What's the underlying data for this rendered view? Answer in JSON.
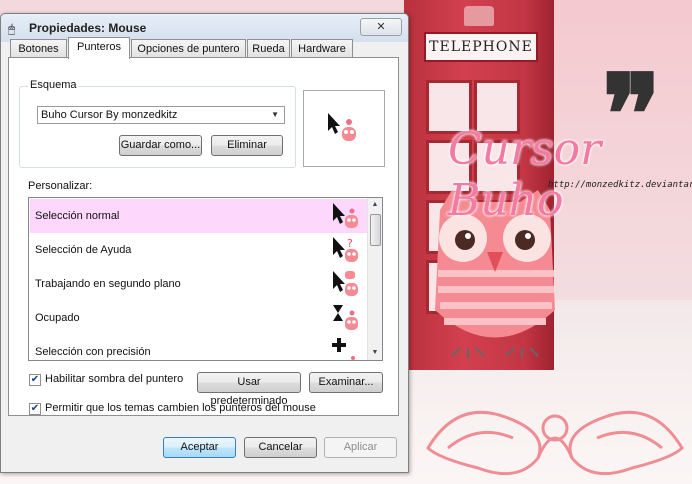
{
  "window": {
    "title": "Propiedades: Mouse",
    "close_label": "✕"
  },
  "tabs": [
    {
      "label": "Botones"
    },
    {
      "label": "Punteros"
    },
    {
      "label": "Opciones de puntero"
    },
    {
      "label": "Rueda"
    },
    {
      "label": "Hardware"
    }
  ],
  "scheme": {
    "group_label": "Esquema",
    "selected": "Buho Cursor By monzedkitz",
    "save_label": "Guardar como...",
    "delete_label": "Eliminar"
  },
  "customize": {
    "label": "Personalizar:",
    "items": [
      {
        "label": "Selección normal",
        "icon": "arrow-owl-icon"
      },
      {
        "label": "Selección de Ayuda",
        "icon": "help-owl-icon"
      },
      {
        "label": "Trabajando en segundo plano",
        "icon": "working-owl-icon"
      },
      {
        "label": "Ocupado",
        "icon": "hourglass-owl-icon"
      },
      {
        "label": "Selección con precisión",
        "icon": "crosshair-owl-icon"
      }
    ]
  },
  "options": {
    "shadow_label": "Habilitar sombra del puntero",
    "shadow_checked": true,
    "default_label": "Usar predeterminado",
    "browse_label": "Examinar...",
    "themes_label": "Permitir que los temas cambien los punteros del mouse",
    "themes_checked": true
  },
  "footer": {
    "ok_label": "Aceptar",
    "cancel_label": "Cancelar",
    "apply_label": "Aplicar"
  },
  "wallpaper": {
    "sign_text": "TELEPHONE",
    "title": "Cursor Buho",
    "url": "http://monzedkitz.deviantart.com/",
    "quote": "❞"
  },
  "colors": {
    "selection": "#fdd7fc",
    "accent_pink": "#f37aa3",
    "booth_red": "#c33645"
  }
}
